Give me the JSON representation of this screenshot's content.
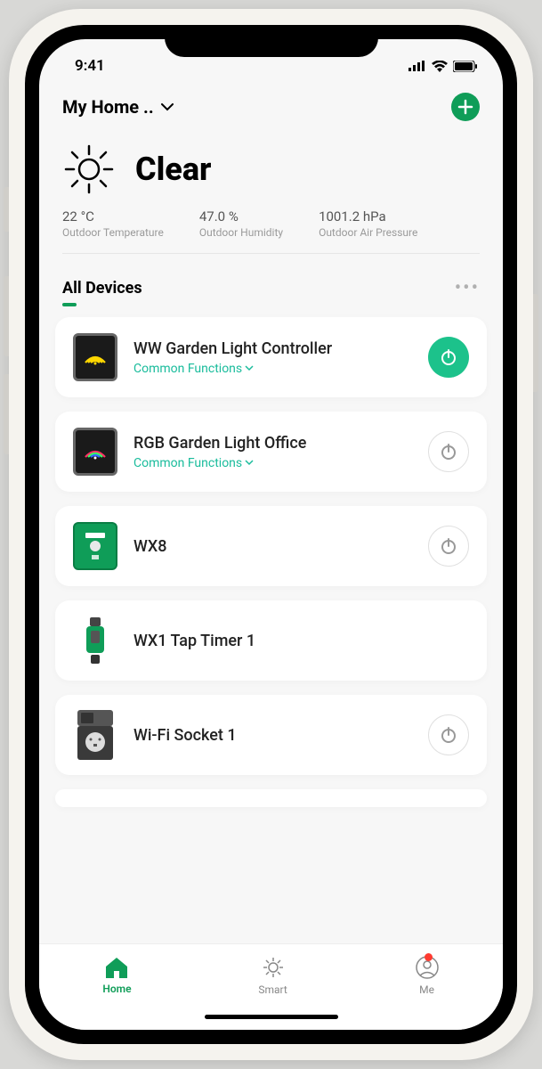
{
  "status": {
    "time": "9:41"
  },
  "header": {
    "home_name": "My Home .."
  },
  "weather": {
    "condition": "Clear",
    "stats": [
      {
        "value": "22 °C",
        "label": "Outdoor Temperature"
      },
      {
        "value": "47.0 %",
        "label": "Outdoor Humidity"
      },
      {
        "value": "1001.2 hPa",
        "label": "Outdoor Air Pressure"
      }
    ]
  },
  "tabs": {
    "active": "All Devices"
  },
  "common_functions_label": "Common Functions",
  "devices": [
    {
      "name": "WW Garden Light Controller",
      "has_sub": true,
      "power_on": true
    },
    {
      "name": "RGB Garden Light Office",
      "has_sub": true,
      "power_on": false
    },
    {
      "name": "WX8",
      "has_sub": false,
      "power_on": false
    },
    {
      "name": "WX1 Tap Timer 1",
      "has_sub": false,
      "power_on": null
    },
    {
      "name": "Wi-Fi Socket 1",
      "has_sub": false,
      "power_on": false
    }
  ],
  "nav": {
    "items": [
      {
        "label": "Home",
        "active": true
      },
      {
        "label": "Smart",
        "active": false
      },
      {
        "label": "Me",
        "active": false,
        "badge": true
      }
    ]
  }
}
